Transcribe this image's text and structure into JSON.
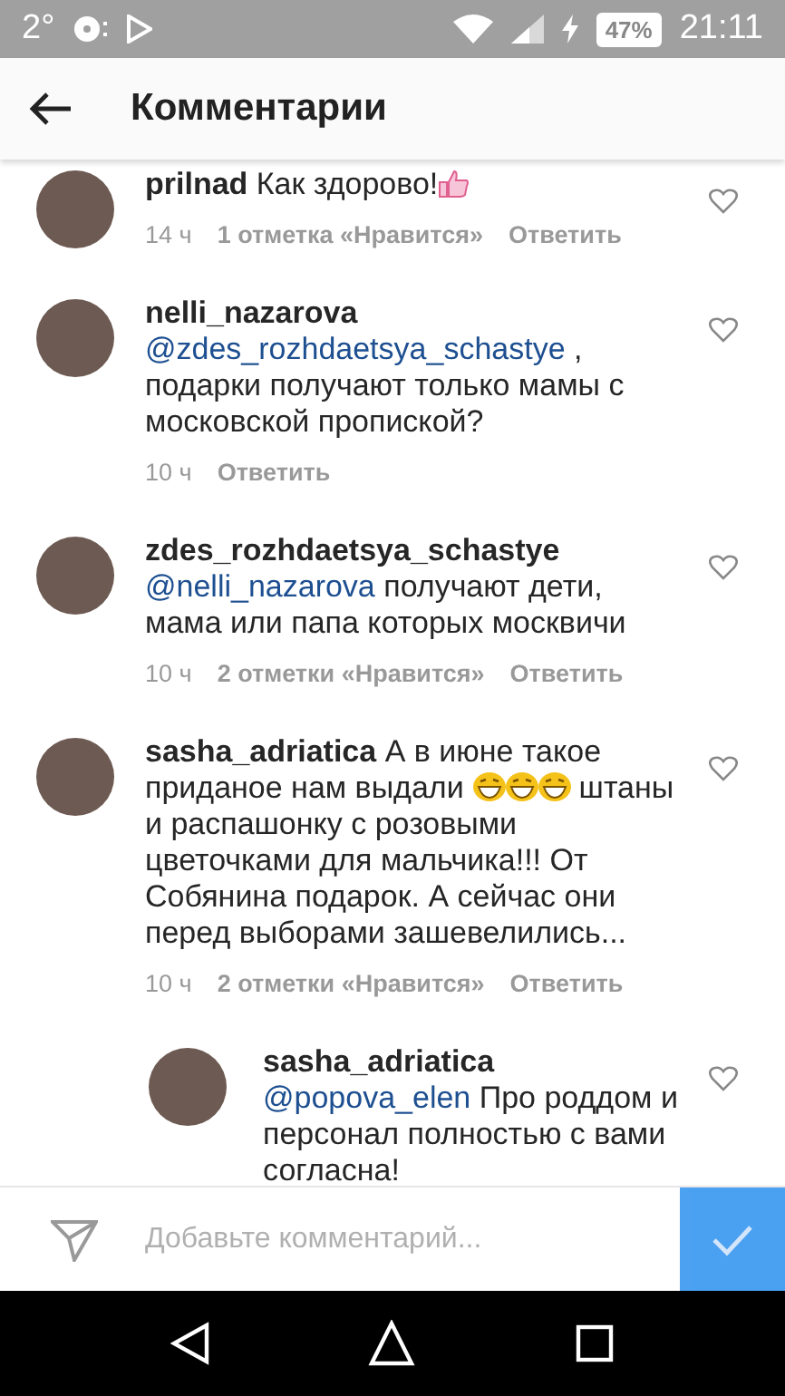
{
  "status_bar": {
    "temperature": "2°",
    "battery": "47%",
    "time": "21:11"
  },
  "header": {
    "title": "Комментарии"
  },
  "comments": [
    {
      "username": "prilnad",
      "segments": [
        {
          "kind": "text",
          "text": "Как здорово!"
        },
        {
          "kind": "thumbs"
        }
      ],
      "time": "14 ч",
      "likes": "1 отметка «Нравится»",
      "reply_label": "Ответить"
    },
    {
      "username": "nelli_nazarova",
      "segments": [
        {
          "kind": "break"
        },
        {
          "kind": "mention",
          "text": "@zdes_rozhdaetsya_schastye"
        },
        {
          "kind": "text",
          "text": " , подарки получают только мамы с московской пропиской?"
        }
      ],
      "time": "10 ч",
      "reply_label": "Ответить"
    },
    {
      "username": "zdes_rozhdaetsya_schastye",
      "segments": [
        {
          "kind": "break"
        },
        {
          "kind": "mention",
          "text": "@nelli_nazarova"
        },
        {
          "kind": "text",
          "text": " получают дети, мама или папа которых москвичи"
        }
      ],
      "time": "10 ч",
      "likes": "2 отметки «Нравится»",
      "reply_label": "Ответить"
    },
    {
      "username": "sasha_adriatica",
      "segments": [
        {
          "kind": "text",
          "text": "А в июне такое приданое нам выдали "
        },
        {
          "kind": "laugh"
        },
        {
          "kind": "laugh"
        },
        {
          "kind": "laugh"
        },
        {
          "kind": "text",
          "text": " штаны и распашонку с розовыми цветочками для мальчика!!! От Собянина подарок. А сейчас они перед выборами зашевелились..."
        }
      ],
      "time": "10 ч",
      "likes": "2 отметки «Нравится»",
      "reply_label": "Ответить",
      "children": [
        {
          "username": "sasha_adriatica",
          "segments": [
            {
              "kind": "mention",
              "text": "@popova_elen"
            },
            {
              "kind": "text",
              "text": " Про роддом и персонал полностью с вами согласна!"
            }
          ]
        }
      ]
    }
  ],
  "composer": {
    "placeholder": "Добавьте комментарий..."
  }
}
